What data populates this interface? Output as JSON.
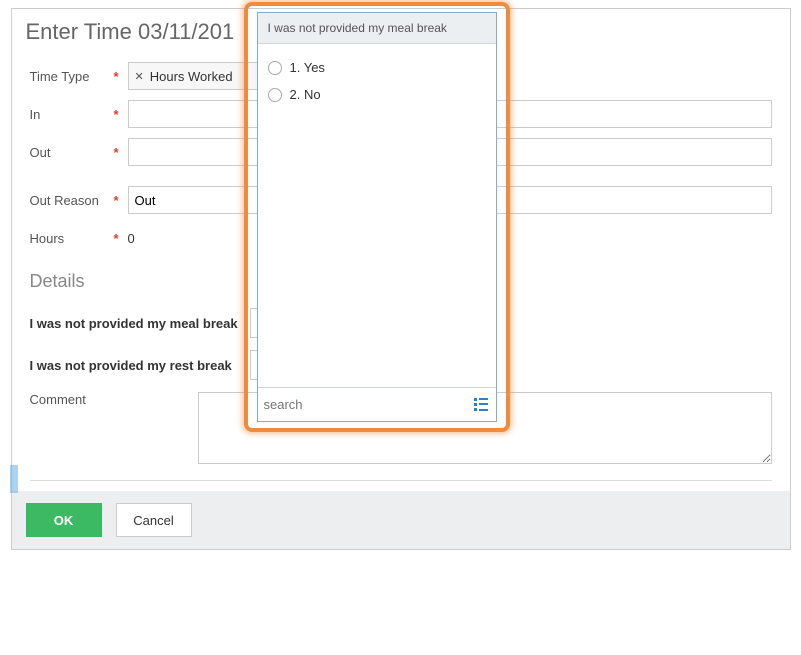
{
  "header": {
    "title": "Enter Time  03/11/201"
  },
  "fields": {
    "time_type": {
      "label": "Time Type",
      "chip": "Hours Worked"
    },
    "in": {
      "label": "In",
      "value": ""
    },
    "out": {
      "label": "Out",
      "value": ""
    },
    "out_reason": {
      "label": "Out Reason",
      "value": "Out"
    },
    "hours": {
      "label": "Hours",
      "value": "0"
    }
  },
  "details": {
    "header": "Details",
    "meal_break_label": "I was not provided my meal break",
    "rest_break_label": "I was not provided my rest break",
    "comment_label": "Comment",
    "comment_value": ""
  },
  "popup": {
    "title": "I was not provided my meal break",
    "options": [
      {
        "label": "1. Yes"
      },
      {
        "label": "2. No"
      }
    ],
    "search_placeholder": "search"
  },
  "footer": {
    "ok": "OK",
    "cancel": "Cancel"
  },
  "req_mark": "*"
}
